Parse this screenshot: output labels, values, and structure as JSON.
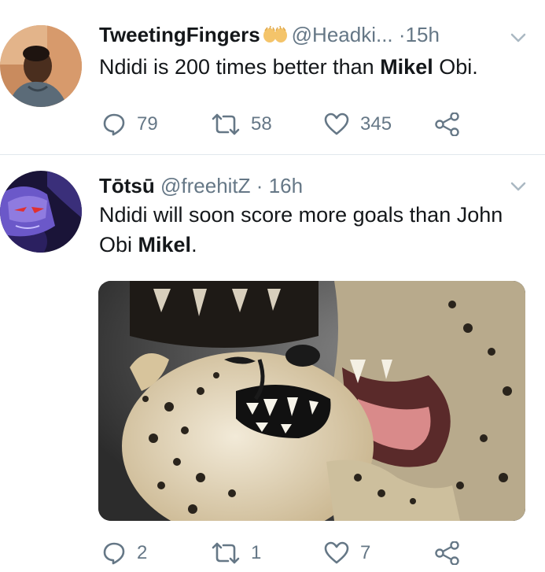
{
  "tweets": [
    {
      "name": "TweetingFingers",
      "handle": "@Headki...",
      "time": "15h",
      "separator": "·",
      "emoji": "raised-hands-emoji",
      "text_before": "Ndidi is 200 times better than ",
      "text_bold": "Mikel",
      "text_after": " Obi.",
      "replies": "79",
      "retweets": "58",
      "likes": "345"
    },
    {
      "name": "Tōtsū",
      "handle": "@freehitZ",
      "time": "16h",
      "separator": "·",
      "text_before": "Ndidi will soon score more goals than John Obi ",
      "text_bold": "Mikel",
      "text_after": ".",
      "media": "laughing-cheetah-photo",
      "replies": "2",
      "retweets": "1",
      "likes": "7"
    }
  ],
  "colors": {
    "text": "#14171a",
    "secondary": "#657786",
    "divider": "#e1e8ed",
    "chevron": "#aab8c2"
  },
  "icons": [
    "reply-icon",
    "retweet-icon",
    "like-icon",
    "share-icon",
    "chevron-down-icon"
  ]
}
